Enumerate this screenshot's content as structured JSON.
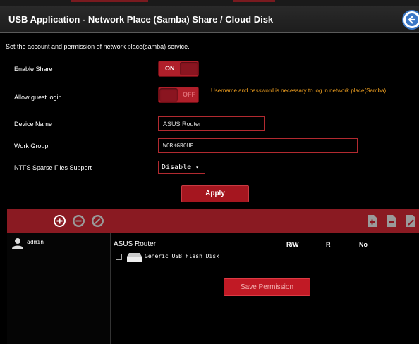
{
  "header": {
    "title": "USB Application - Network Place (Samba) Share / Cloud Disk",
    "back_icon": "back-arrow-icon"
  },
  "description": "Set the account and permission of network place(samba) service.",
  "enable_share": {
    "label": "Enable Share",
    "state": "ON"
  },
  "guest_login": {
    "label": "Allow guest login",
    "state": "OFF",
    "note": "Username and password is necessary to log in network place(Samba)"
  },
  "device_name": {
    "label": "Device Name",
    "value": "ASUS Router"
  },
  "work_group": {
    "label": "Work Group",
    "value": "WORKGROUP"
  },
  "ntfs": {
    "label": "NTFS Sparse Files Support",
    "value": "Disable",
    "arrow": "▾"
  },
  "apply_label": "Apply",
  "account_toolbar": {
    "icons": [
      "add-account-icon",
      "delete-account-icon",
      "edit-account-icon",
      "add-folder-icon",
      "delete-folder-icon",
      "rename-folder-icon"
    ]
  },
  "accounts": [
    {
      "name": "admin"
    }
  ],
  "permissions": {
    "device": "ASUS Router",
    "columns": [
      "R/W",
      "R",
      "No"
    ],
    "disk": "Generic USB Flash Disk",
    "expand_symbol": "+"
  },
  "save_permission_label": "Save Permission",
  "colors": {
    "accent": "#a5161f",
    "note": "#f0a020",
    "background": "#000000"
  }
}
